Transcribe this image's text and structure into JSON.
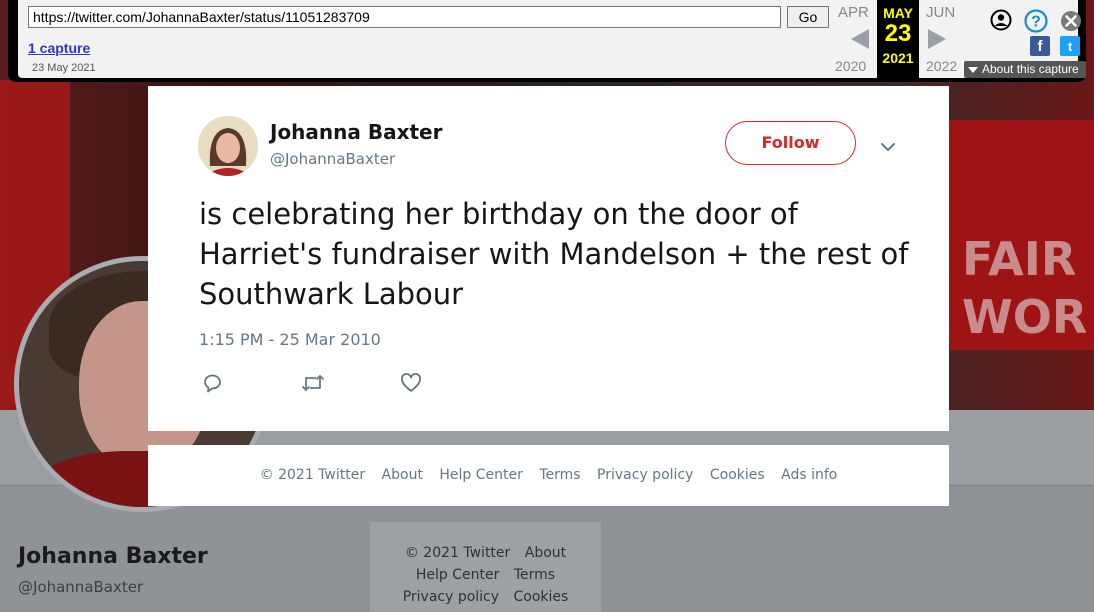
{
  "wayback": {
    "url": "https://twitter.com/JohannaBaxter/status/11051283709",
    "go_label": "Go",
    "captures_label": "1 capture",
    "capture_date": "23 May 2021",
    "prev_month": "APR",
    "prev_year": "2020",
    "current_month": "MAY",
    "current_day": "23",
    "current_year": "2021",
    "next_month": "JUN",
    "next_year": "2022",
    "about_label": "About this capture",
    "icons": [
      "user-icon",
      "help-icon",
      "close-icon",
      "facebook-icon",
      "twitter-icon"
    ]
  },
  "background": {
    "banner_line1": "FAIR D",
    "banner_line2": "WOR",
    "profile_name": "Johanna Baxter",
    "profile_handle": "@JohannaBaxter",
    "footer_links": [
      "© 2021 Twitter",
      "About",
      "Help Center",
      "Terms",
      "Privacy policy",
      "Cookies"
    ]
  },
  "tweet": {
    "author_name": "Johanna Baxter",
    "author_handle": "@JohannaBaxter",
    "follow_label": "Follow",
    "text": "is celebrating her birthday on the door of Harriet's fundraiser with Mandelson + the rest of Southwark Labour",
    "timestamp": "1:15 PM - 25 Mar 2010",
    "accent_color": "#e0242b",
    "actions": [
      "reply-icon",
      "retweet-icon",
      "like-icon"
    ]
  },
  "footer": {
    "links": [
      "© 2021 Twitter",
      "About",
      "Help Center",
      "Terms",
      "Privacy policy",
      "Cookies",
      "Ads info"
    ]
  }
}
